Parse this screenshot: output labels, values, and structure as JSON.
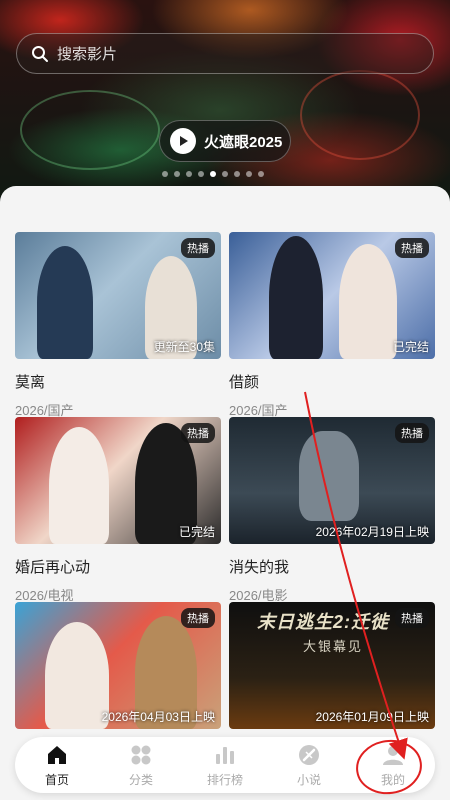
{
  "search": {
    "placeholder": "搜索影片"
  },
  "hero": {
    "title": "火遮眼2025",
    "dots_count": 9,
    "active_dot": 4
  },
  "cards": [
    {
      "title": "莫离",
      "meta": "2026/国产",
      "badge": "热播",
      "status": "更新至30集"
    },
    {
      "title": "借颜",
      "meta": "2026/国产",
      "badge": "热播",
      "status": "已完结"
    },
    {
      "title": "婚后再心动",
      "meta": "2026/电视",
      "badge": "热播",
      "status": "已完结"
    },
    {
      "title": "消失的我",
      "meta": "2026/电影",
      "badge": "热播",
      "status": "2026年02月19日上映"
    },
    {
      "title": "",
      "meta": "",
      "badge": "热播",
      "status": "2026年04月03日上映"
    },
    {
      "title": "",
      "meta": "",
      "badge": "热播",
      "status": "2026年01月09日上映",
      "poster_title": "末日逃生2:迁徙",
      "poster_sub": "大银幕见"
    }
  ],
  "nav": [
    {
      "label": "首页",
      "icon": "home-icon",
      "active": true
    },
    {
      "label": "分类",
      "icon": "category-icon",
      "active": false
    },
    {
      "label": "排行榜",
      "icon": "ranking-icon",
      "active": false
    },
    {
      "label": "小说",
      "icon": "novel-icon",
      "active": false
    },
    {
      "label": "我的",
      "icon": "profile-icon",
      "active": false
    }
  ],
  "colors": {
    "accent": "#222222",
    "inactive": "#aaaaaa",
    "annotation": "#e02020"
  }
}
